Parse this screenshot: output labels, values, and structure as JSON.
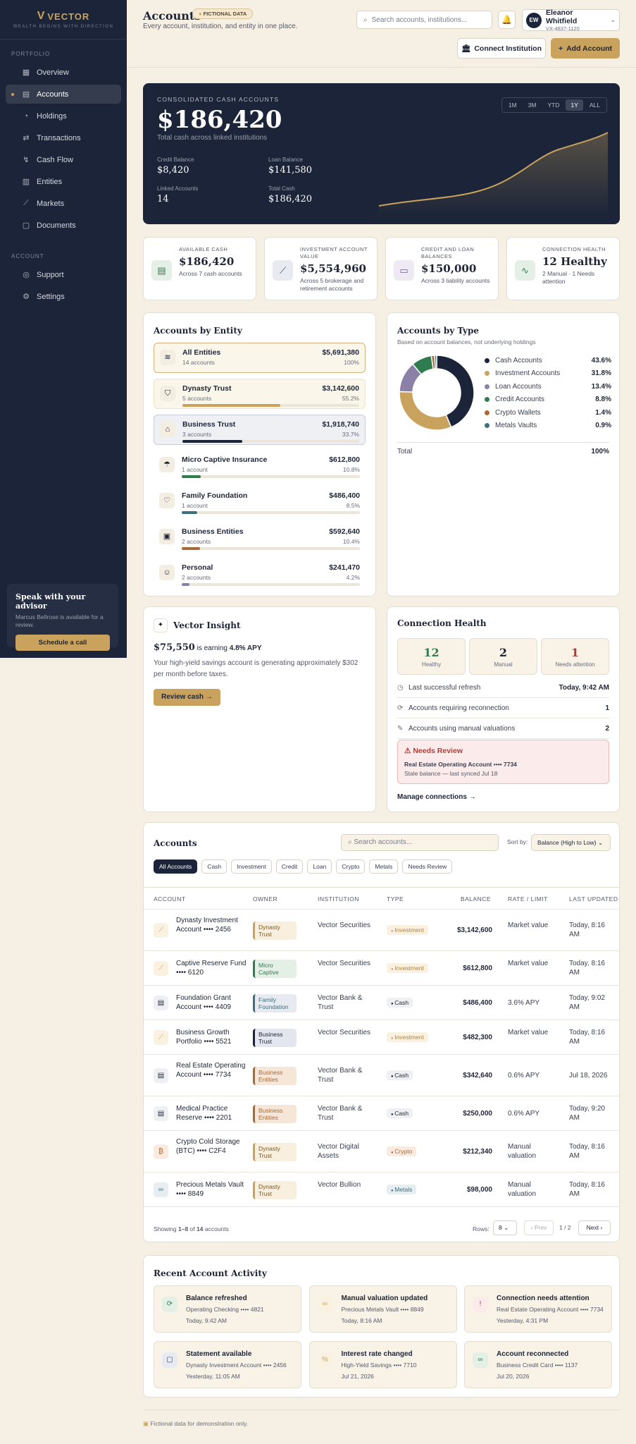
{
  "brand": {
    "name": "VECTOR",
    "tagline": "WEALTH BEGINS WITH DIRECTION"
  },
  "sidebar": {
    "portfolio_label": "PORTFOLIO",
    "account_label": "ACCOUNT",
    "items": [
      {
        "label": "Overview",
        "icon": "grid-icon"
      },
      {
        "label": "Accounts",
        "icon": "wallet-icon",
        "active": true
      },
      {
        "label": "Holdings",
        "icon": "pie-icon"
      },
      {
        "label": "Transactions",
        "icon": "swap-icon"
      },
      {
        "label": "Cash Flow",
        "icon": "flow-icon"
      },
      {
        "label": "Entities",
        "icon": "building-icon"
      },
      {
        "label": "Markets",
        "icon": "chart-icon"
      },
      {
        "label": "Documents",
        "icon": "document-icon"
      }
    ],
    "account_items": [
      {
        "label": "Support",
        "icon": "support-icon"
      },
      {
        "label": "Settings",
        "icon": "gear-icon"
      }
    ],
    "advisor": {
      "title": "Speak with your advisor",
      "text": "Marcus Bellrose is available for a review.",
      "button": "Schedule a call"
    }
  },
  "header": {
    "title": "Accounts",
    "badge": "FICTIONAL DATA",
    "subtitle": "Every account, institution, and entity in one place.",
    "search_placeholder": "Search accounts, institutions...",
    "user_name": "Eleanor Whitfield",
    "user_id": "VX-4837-1120",
    "user_initials": "EW",
    "connect_label": "Connect Institution",
    "add_label": "Add Account"
  },
  "hero": {
    "label": "CONSOLIDATED CASH ACCOUNTS",
    "value": "$186,420",
    "sub": "Total cash across linked institutions",
    "stats": [
      {
        "label": "Credit Balance",
        "value": "$8,420"
      },
      {
        "label": "Loan Balance",
        "value": "$141,580"
      },
      {
        "label": "Linked Accounts",
        "value": "14"
      },
      {
        "label": "Total Cash",
        "value": "$186,420"
      }
    ],
    "ranges": [
      "1M",
      "3M",
      "YTD",
      "1Y",
      "ALL"
    ],
    "active_range": "1Y"
  },
  "kpis": [
    {
      "label": "AVAILABLE CASH",
      "value": "$186,420",
      "sub": "Across 7 cash accounts",
      "icon": "wallet-icon"
    },
    {
      "label": "INVESTMENT ACCOUNT VALUE",
      "value": "$5,554,960",
      "sub": "Across 5 brokerage and retirement accounts",
      "icon": "chart-icon"
    },
    {
      "label": "CREDIT AND LOAN BALANCES",
      "value": "$150,000",
      "sub": "Across 3 liability accounts",
      "icon": "card-icon"
    },
    {
      "label": "CONNECTION HEALTH",
      "value": "12 Healthy",
      "sub": "2 Manual · 1 Needs attention",
      "icon": "pulse-icon"
    }
  ],
  "entities": {
    "title": "Accounts by Entity",
    "items": [
      {
        "name": "All Entities",
        "sub": "14 accounts",
        "amount": "$5,691,380",
        "pct": "100%",
        "fill": 0,
        "color": "#c9a35e",
        "icon": "layers-icon"
      },
      {
        "name": "Dynasty Trust",
        "sub": "5 accounts",
        "amount": "$3,142,600",
        "pct": "55.2%",
        "fill": 55.2,
        "color": "#c9a35e",
        "icon": "shield-icon"
      },
      {
        "name": "Business Trust",
        "sub": "3 accounts",
        "amount": "$1,918,740",
        "pct": "33.7%",
        "fill": 33.7,
        "color": "#1b2438",
        "icon": "bank-icon"
      },
      {
        "name": "Micro Captive Insurance",
        "sub": "1 account",
        "amount": "$612,800",
        "pct": "10.8%",
        "fill": 10.8,
        "color": "#2f7d4f",
        "icon": "umbrella-icon"
      },
      {
        "name": "Family Foundation",
        "sub": "1 account",
        "amount": "$486,400",
        "pct": "8.5%",
        "fill": 8.5,
        "color": "#3d6f7c",
        "icon": "heart-icon"
      },
      {
        "name": "Business Entities",
        "sub": "2 accounts",
        "amount": "$592,640",
        "pct": "10.4%",
        "fill": 10.4,
        "color": "#a86a38",
        "icon": "briefcase-icon"
      },
      {
        "name": "Personal",
        "sub": "2 accounts",
        "amount": "$241,470",
        "pct": "4.2%",
        "fill": 4.2,
        "color": "#8a80a8",
        "icon": "person-icon"
      }
    ]
  },
  "by_type": {
    "title": "Accounts by Type",
    "sub": "Based on account balances, not underlying holdings",
    "total_label": "Total",
    "total_pct": "100%"
  },
  "chart_data": {
    "type": "pie",
    "categories": [
      "Cash Accounts",
      "Investment Accounts",
      "Loan Accounts",
      "Credit Accounts",
      "Crypto Wallets",
      "Metals Vaults"
    ],
    "values": [
      43.6,
      31.8,
      13.4,
      8.8,
      1.4,
      0.9
    ],
    "labels": [
      "43.6%",
      "31.8%",
      "13.4%",
      "8.8%",
      "1.4%",
      "0.9%"
    ],
    "colors": [
      "#1b2438",
      "#c9a35e",
      "#8a80a8",
      "#2f7d4f",
      "#a86a38",
      "#3d6f7c"
    ]
  },
  "insight": {
    "title": "Vector Insight",
    "amount": "$75,550",
    "mid": "is earning",
    "apy": "4.8% APY",
    "body": "Your high-yield savings account is generating approximately $302 per month before taxes.",
    "button": "Review cash"
  },
  "health": {
    "title": "Connection Health",
    "boxes": [
      {
        "n": "12",
        "label": "Healthy",
        "color": "#2f7d4f"
      },
      {
        "n": "2",
        "label": "Manual",
        "color": "#1e2536"
      },
      {
        "n": "1",
        "label": "Needs attention",
        "color": "#b23a36"
      }
    ],
    "rows": [
      {
        "label": "Last successful refresh",
        "value": "Today, 9:42 AM",
        "icon": "clock-icon"
      },
      {
        "label": "Accounts requiring reconnection",
        "value": "1",
        "icon": "refresh-icon"
      },
      {
        "label": "Accounts using manual valuations",
        "value": "2",
        "icon": "pencil-icon"
      }
    ],
    "alert_title": "Needs Review",
    "alert_line1": "Real Estate Operating Account •••• 7734",
    "alert_line2": "Stale balance — last synced Jul 18",
    "manage": "Manage connections"
  },
  "accounts": {
    "title": "Accounts",
    "search_placeholder": "Search accounts...",
    "sort_label": "Sort by:",
    "sort_value": "Balance (High to Low)",
    "filters": [
      "All Accounts",
      "Cash",
      "Investment",
      "Credit",
      "Loan",
      "Crypto",
      "Metals",
      "Needs Review"
    ],
    "columns": [
      "ACCOUNT",
      "OWNER",
      "INSTITUTION",
      "TYPE",
      "BALANCE",
      "RATE / LIMIT",
      "LAST UPDATED"
    ],
    "rows": [
      {
        "name": "Dynasty Investment Account •••• 2456",
        "owner": "Dynasty Trust",
        "inst": "Vector Securities",
        "type": "Investment",
        "balance": "$3,142,600",
        "rate": "Market value",
        "updated": "Today, 8:16 AM"
      },
      {
        "name": "Captive Reserve Fund •••• 6120",
        "owner": "Micro Captive",
        "inst": "Vector Securities",
        "type": "Investment",
        "balance": "$612,800",
        "rate": "Market value",
        "updated": "Today, 8:16 AM"
      },
      {
        "name": "Foundation Grant Account •••• 4409",
        "owner": "Family Foundation",
        "inst": "Vector Bank & Trust",
        "type": "Cash",
        "balance": "$486,400",
        "rate": "3.6% APY",
        "updated": "Today, 9:02 AM"
      },
      {
        "name": "Business Growth Portfolio •••• 5521",
        "owner": "Business Trust",
        "inst": "Vector Securities",
        "type": "Investment",
        "balance": "$482,300",
        "rate": "Market value",
        "updated": "Today, 8:16 AM"
      },
      {
        "name": "Real Estate Operating Account •••• 7734",
        "owner": "Business Entities",
        "inst": "Vector Bank & Trust",
        "type": "Cash",
        "balance": "$342,640",
        "rate": "0.6% APY",
        "updated": "Jul 18, 2026"
      },
      {
        "name": "Medical Practice Reserve •••• 2201",
        "owner": "Business Entities",
        "inst": "Vector Bank & Trust",
        "type": "Cash",
        "balance": "$250,000",
        "rate": "0.6% APY",
        "updated": "Today, 9:20 AM"
      },
      {
        "name": "Crypto Cold Storage (BTC) •••• C2F4",
        "owner": "Dynasty Trust",
        "inst": "Vector Digital Assets",
        "type": "Crypto",
        "balance": "$212,340",
        "rate": "Manual valuation",
        "updated": "Today, 8:16 AM"
      },
      {
        "name": "Precious Metals Vault •••• 8849",
        "owner": "Dynasty Trust",
        "inst": "Vector Bullion",
        "type": "Metals",
        "balance": "$98,000",
        "rate": "Manual valuation",
        "updated": "Today, 8:16 AM"
      }
    ],
    "showing_prefix": "Showing",
    "showing_range": "1–8",
    "showing_of": "of",
    "showing_total": "14",
    "showing_suffix": "accounts",
    "rows_label": "Rows:",
    "rows_value": "8",
    "prev": "Prev",
    "page": "1 / 2",
    "next": "Next"
  },
  "activity": {
    "title": "Recent Account Activity",
    "items": [
      {
        "title": "Balance refreshed",
        "sub": "Operating Checking •••• 4821",
        "date": "Today, 9:42 AM",
        "icon": "refresh-icon"
      },
      {
        "title": "Manual valuation updated",
        "sub": "Precious Metals Vault •••• 8849",
        "date": "Today, 8:16 AM",
        "icon": "link-icon"
      },
      {
        "title": "Connection needs attention",
        "sub": "Real Estate Operating Account •••• 7734",
        "date": "Yesterday, 4:31 PM",
        "icon": "alert-icon"
      },
      {
        "title": "Statement available",
        "sub": "Dynasty Investment Account •••• 2456",
        "date": "Yesterday, 11:05 AM",
        "icon": "document-icon"
      },
      {
        "title": "Interest rate changed",
        "sub": "High-Yield Savings •••• 7710",
        "date": "Jul 21, 2026",
        "icon": "percent-icon"
      },
      {
        "title": "Account reconnected",
        "sub": "Business Credit Card •••• 1137",
        "date": "Jul 20, 2026",
        "icon": "link-icon"
      }
    ]
  },
  "footer": {
    "text": "Fictional data for demonstration only."
  }
}
